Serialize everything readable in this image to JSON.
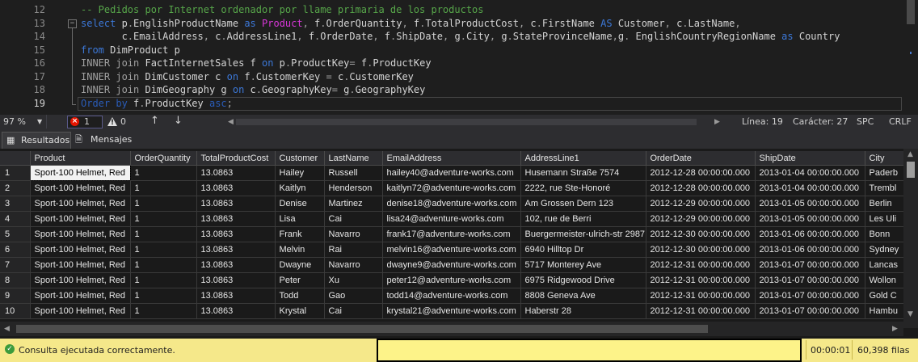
{
  "editor": {
    "line_numbers": [
      "12",
      "13",
      "14",
      "15",
      "16",
      "17",
      "18",
      "19"
    ],
    "code_lines": [
      [
        {
          "t": "-- Pedidos por Internet ordenador por llame primaria de los productos",
          "c": "cmt"
        }
      ],
      [
        {
          "t": "select ",
          "c": "kw"
        },
        {
          "t": "p",
          "c": "id"
        },
        {
          "t": ".",
          "c": "op"
        },
        {
          "t": "EnglishProductName ",
          "c": "id"
        },
        {
          "t": "as ",
          "c": "kw"
        },
        {
          "t": "Product",
          "c": "mag"
        },
        {
          "t": ", ",
          "c": "op"
        },
        {
          "t": "f",
          "c": "id"
        },
        {
          "t": ".",
          "c": "op"
        },
        {
          "t": "OrderQuantity",
          "c": "id"
        },
        {
          "t": ", ",
          "c": "op"
        },
        {
          "t": "f",
          "c": "id"
        },
        {
          "t": ".",
          "c": "op"
        },
        {
          "t": "TotalProductCost",
          "c": "id"
        },
        {
          "t": ", ",
          "c": "op"
        },
        {
          "t": "c",
          "c": "id"
        },
        {
          "t": ".",
          "c": "op"
        },
        {
          "t": "FirstName ",
          "c": "id"
        },
        {
          "t": "AS ",
          "c": "kw"
        },
        {
          "t": "Customer",
          "c": "id"
        },
        {
          "t": ", ",
          "c": "op"
        },
        {
          "t": "c",
          "c": "id"
        },
        {
          "t": ".",
          "c": "op"
        },
        {
          "t": "LastName",
          "c": "id"
        },
        {
          "t": ",",
          "c": "op"
        }
      ],
      [
        {
          "t": "       c",
          "c": "id"
        },
        {
          "t": ".",
          "c": "op"
        },
        {
          "t": "EmailAddress",
          "c": "id"
        },
        {
          "t": ", ",
          "c": "op"
        },
        {
          "t": "c",
          "c": "id"
        },
        {
          "t": ".",
          "c": "op"
        },
        {
          "t": "AddressLine1",
          "c": "id"
        },
        {
          "t": ", ",
          "c": "op"
        },
        {
          "t": "f",
          "c": "id"
        },
        {
          "t": ".",
          "c": "op"
        },
        {
          "t": "OrderDate",
          "c": "id"
        },
        {
          "t": ", ",
          "c": "op"
        },
        {
          "t": "f",
          "c": "id"
        },
        {
          "t": ".",
          "c": "op"
        },
        {
          "t": "ShipDate",
          "c": "id"
        },
        {
          "t": ", ",
          "c": "op"
        },
        {
          "t": "g",
          "c": "id"
        },
        {
          "t": ".",
          "c": "op"
        },
        {
          "t": "City",
          "c": "id"
        },
        {
          "t": ", ",
          "c": "op"
        },
        {
          "t": "g",
          "c": "id"
        },
        {
          "t": ".",
          "c": "op"
        },
        {
          "t": "StateProvinceName",
          "c": "id"
        },
        {
          "t": ",",
          "c": "op"
        },
        {
          "t": "g",
          "c": "id"
        },
        {
          "t": ". ",
          "c": "op"
        },
        {
          "t": "EnglishCountryRegionName ",
          "c": "id"
        },
        {
          "t": "as ",
          "c": "kw"
        },
        {
          "t": "Country",
          "c": "id"
        }
      ],
      [
        {
          "t": "from ",
          "c": "kw"
        },
        {
          "t": "DimProduct p",
          "c": "id"
        }
      ],
      [
        {
          "t": "INNER join ",
          "c": "op"
        },
        {
          "t": "FactInternetSales f ",
          "c": "id"
        },
        {
          "t": "on ",
          "c": "kw"
        },
        {
          "t": "p",
          "c": "id"
        },
        {
          "t": ".",
          "c": "op"
        },
        {
          "t": "ProductKey",
          "c": "id"
        },
        {
          "t": "= ",
          "c": "op"
        },
        {
          "t": "f",
          "c": "id"
        },
        {
          "t": ".",
          "c": "op"
        },
        {
          "t": "ProductKey",
          "c": "id"
        }
      ],
      [
        {
          "t": "INNER join ",
          "c": "op"
        },
        {
          "t": "DimCustomer c ",
          "c": "id"
        },
        {
          "t": "on ",
          "c": "kw"
        },
        {
          "t": "f",
          "c": "id"
        },
        {
          "t": ".",
          "c": "op"
        },
        {
          "t": "CustomerKey ",
          "c": "id"
        },
        {
          "t": "= ",
          "c": "op"
        },
        {
          "t": "c",
          "c": "id"
        },
        {
          "t": ".",
          "c": "op"
        },
        {
          "t": "CustomerKey",
          "c": "id"
        }
      ],
      [
        {
          "t": "INNER join ",
          "c": "op"
        },
        {
          "t": "DimGeography g ",
          "c": "id"
        },
        {
          "t": "on ",
          "c": "kw"
        },
        {
          "t": "c",
          "c": "id"
        },
        {
          "t": ".",
          "c": "op"
        },
        {
          "t": "GeographyKey",
          "c": "id"
        },
        {
          "t": "= ",
          "c": "op"
        },
        {
          "t": "g",
          "c": "id"
        },
        {
          "t": ".",
          "c": "op"
        },
        {
          "t": "GeographyKey",
          "c": "id"
        }
      ],
      [
        {
          "t": "Order by ",
          "c": "kwd"
        },
        {
          "t": "f",
          "c": "id"
        },
        {
          "t": ".",
          "c": "op"
        },
        {
          "t": "ProductKey ",
          "c": "id"
        },
        {
          "t": "asc",
          "c": "kwd"
        },
        {
          "t": ";",
          "c": "op"
        }
      ]
    ]
  },
  "editor_status": {
    "zoom": "97 %",
    "errors": "1",
    "warnings": "0",
    "line": "Línea: 19",
    "column": "Carácter: 27",
    "mode": "SPC",
    "eol": "CRLF"
  },
  "tabs": {
    "results": "Resultados",
    "messages": "Mensajes"
  },
  "grid": {
    "columns": [
      "Product",
      "OrderQuantity",
      "TotalProductCost",
      "Customer",
      "LastName",
      "EmailAddress",
      "AddressLine1",
      "OrderDate",
      "ShipDate",
      "City"
    ],
    "rows": [
      [
        "1",
        "Sport-100 Helmet, Red",
        "1",
        "13.0863",
        "Hailey",
        "Russell",
        "hailey40@adventure-works.com",
        "Husemann Straße 7574",
        "2012-12-28 00:00:00.000",
        "2013-01-04 00:00:00.000",
        "Paderb"
      ],
      [
        "2",
        "Sport-100 Helmet, Red",
        "1",
        "13.0863",
        "Kaitlyn",
        "Henderson",
        "kaitlyn72@adventure-works.com",
        "2222, rue Ste-Honoré",
        "2012-12-28 00:00:00.000",
        "2013-01-04 00:00:00.000",
        "Trembl"
      ],
      [
        "3",
        "Sport-100 Helmet, Red",
        "1",
        "13.0863",
        "Denise",
        "Martinez",
        "denise18@adventure-works.com",
        "Am Grossen Dern 123",
        "2012-12-29 00:00:00.000",
        "2013-01-05 00:00:00.000",
        "Berlin"
      ],
      [
        "4",
        "Sport-100 Helmet, Red",
        "1",
        "13.0863",
        "Lisa",
        "Cai",
        "lisa24@adventure-works.com",
        "102, rue de Berri",
        "2012-12-29 00:00:00.000",
        "2013-01-05 00:00:00.000",
        "Les Uli"
      ],
      [
        "5",
        "Sport-100 Helmet, Red",
        "1",
        "13.0863",
        "Frank",
        "Navarro",
        "frank17@adventure-works.com",
        "Buergermeister-ulrich-str 2987",
        "2012-12-30 00:00:00.000",
        "2013-01-06 00:00:00.000",
        "Bonn"
      ],
      [
        "6",
        "Sport-100 Helmet, Red",
        "1",
        "13.0863",
        "Melvin",
        "Rai",
        "melvin16@adventure-works.com",
        "6940 Hilltop Dr",
        "2012-12-30 00:00:00.000",
        "2013-01-06 00:00:00.000",
        "Sydney"
      ],
      [
        "7",
        "Sport-100 Helmet, Red",
        "1",
        "13.0863",
        "Dwayne",
        "Navarro",
        "dwayne9@adventure-works.com",
        "5717 Monterey Ave",
        "2012-12-31 00:00:00.000",
        "2013-01-07 00:00:00.000",
        "Lancas"
      ],
      [
        "8",
        "Sport-100 Helmet, Red",
        "1",
        "13.0863",
        "Peter",
        "Xu",
        "peter12@adventure-works.com",
        "6975 Ridgewood Drive",
        "2012-12-31 00:00:00.000",
        "2013-01-07 00:00:00.000",
        "Wollon"
      ],
      [
        "9",
        "Sport-100 Helmet, Red",
        "1",
        "13.0863",
        "Todd",
        "Gao",
        "todd14@adventure-works.com",
        "8808 Geneva Ave",
        "2012-12-31 00:00:00.000",
        "2013-01-07 00:00:00.000",
        "Gold C"
      ],
      [
        "10",
        "Sport-100 Helmet, Red",
        "1",
        "13.0863",
        "Krystal",
        "Cai",
        "krystal21@adventure-works.com",
        "Haberstr 28",
        "2012-12-31 00:00:00.000",
        "2013-01-07 00:00:00.000",
        "Hambu"
      ]
    ]
  },
  "query_status": {
    "message": "Consulta ejecutada correctamente.",
    "elapsed": "00:00:01",
    "row_count": "60,398 filas"
  }
}
